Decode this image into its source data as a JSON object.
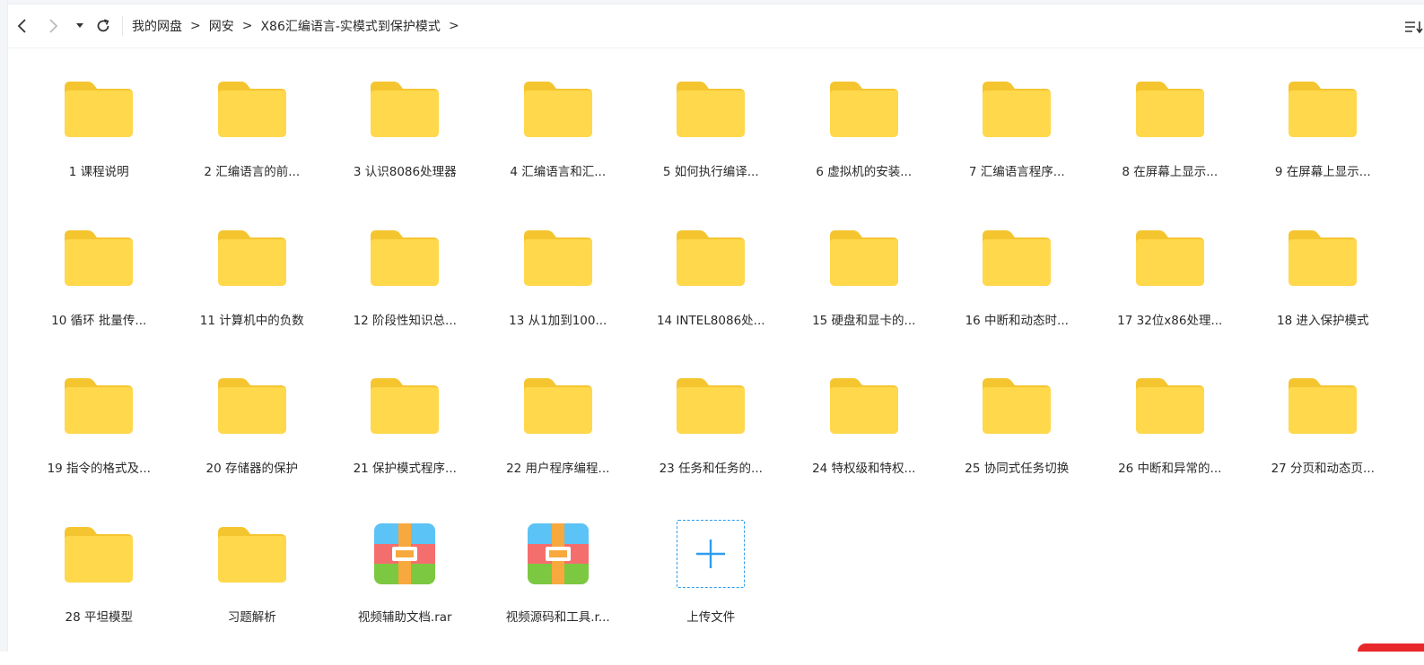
{
  "toolbar": {
    "back_icon": "chevron-left-icon",
    "forward_icon": "chevron-right-icon",
    "history_icon": "caret-down-icon",
    "refresh_icon": "refresh-icon",
    "sort_icon": "sort-list-icon"
  },
  "breadcrumb": [
    "我的网盘",
    "网安",
    "X86汇编语言-实模式到保护模式"
  ],
  "breadcrumb_separator": ">",
  "files": [
    {
      "name": "1 课程说明",
      "type": "folder"
    },
    {
      "name": "2 汇编语言的前...",
      "type": "folder"
    },
    {
      "name": "3 认识8086处理器",
      "type": "folder"
    },
    {
      "name": "4 汇编语言和汇...",
      "type": "folder"
    },
    {
      "name": "5 如何执行编译...",
      "type": "folder"
    },
    {
      "name": "6 虚拟机的安装...",
      "type": "folder"
    },
    {
      "name": "7 汇编语言程序...",
      "type": "folder"
    },
    {
      "name": "8 在屏幕上显示...",
      "type": "folder"
    },
    {
      "name": "9 在屏幕上显示...",
      "type": "folder"
    },
    {
      "name": "10 循环 批量传...",
      "type": "folder"
    },
    {
      "name": "11 计算机中的负数",
      "type": "folder"
    },
    {
      "name": "12 阶段性知识总...",
      "type": "folder"
    },
    {
      "name": "13 从1加到100...",
      "type": "folder"
    },
    {
      "name": "14 INTEL8086处...",
      "type": "folder"
    },
    {
      "name": "15 硬盘和显卡的...",
      "type": "folder"
    },
    {
      "name": "16 中断和动态时...",
      "type": "folder"
    },
    {
      "name": "17 32位x86处理...",
      "type": "folder"
    },
    {
      "name": "18 进入保护模式",
      "type": "folder"
    },
    {
      "name": "19 指令的格式及...",
      "type": "folder"
    },
    {
      "name": "20 存储器的保护",
      "type": "folder"
    },
    {
      "name": "21 保护模式程序...",
      "type": "folder"
    },
    {
      "name": "22 用户程序编程...",
      "type": "folder"
    },
    {
      "name": "23 任务和任务的...",
      "type": "folder"
    },
    {
      "name": "24 特权级和特权...",
      "type": "folder"
    },
    {
      "name": "25 协同式任务切换",
      "type": "folder"
    },
    {
      "name": "26 中断和异常的...",
      "type": "folder"
    },
    {
      "name": "27 分页和动态页...",
      "type": "folder"
    },
    {
      "name": "28 平坦模型",
      "type": "folder"
    },
    {
      "name": "习题解析",
      "type": "folder"
    },
    {
      "name": "视频辅助文档.rar",
      "type": "archive"
    },
    {
      "name": "视频源码和工具.r...",
      "type": "archive"
    }
  ],
  "upload": {
    "label": "上传文件",
    "icon": "plus-icon"
  },
  "colors": {
    "folder_body": "#FFD84C",
    "folder_tab": "#F5C530",
    "accent": "#2E9DF0",
    "archive_blue": "#5BC3F5",
    "archive_red": "#F56E6E",
    "archive_green": "#7CC841",
    "archive_strap": "#F7A93D"
  }
}
